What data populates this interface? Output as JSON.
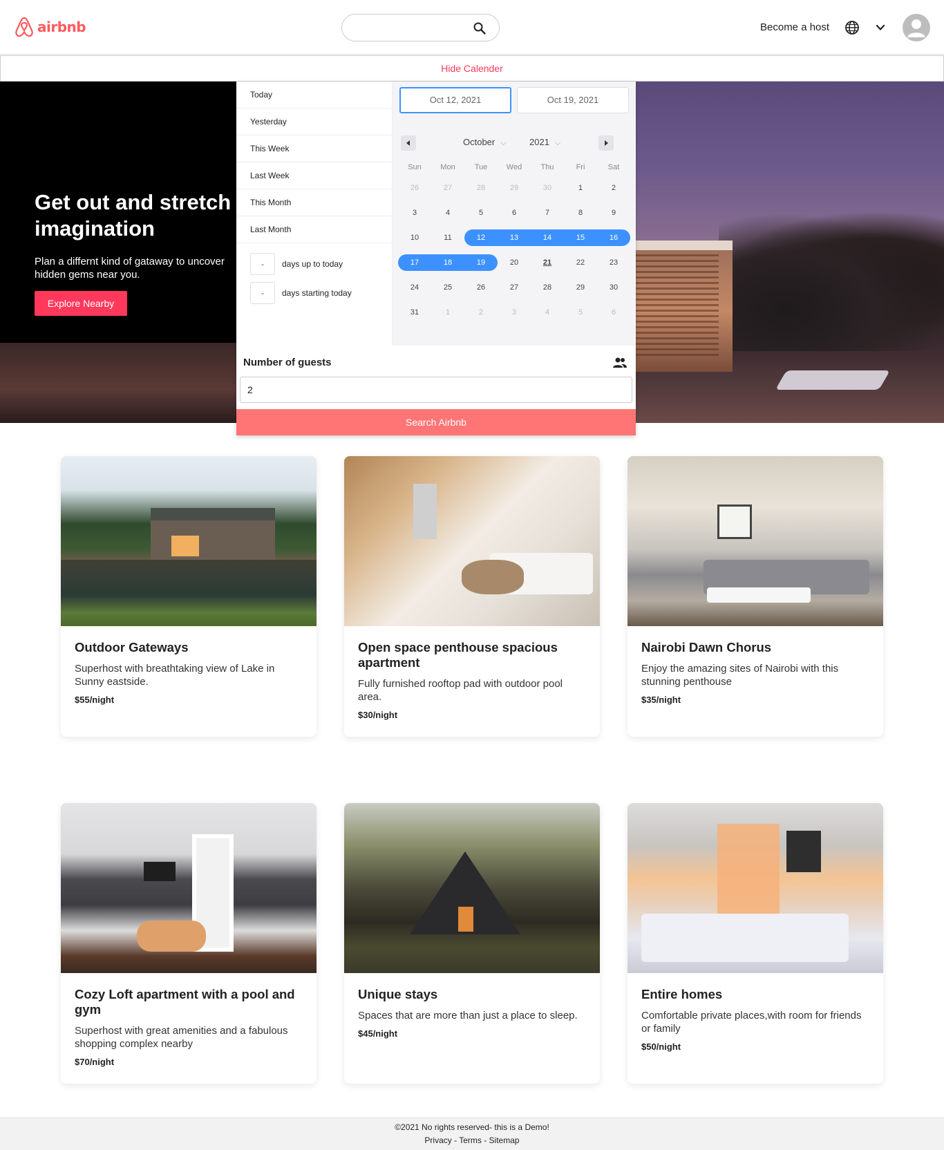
{
  "header": {
    "logo_text": "airbnb",
    "search_placeholder": "",
    "host_link": "Become a host"
  },
  "calendar_toggle": "Hide Calender",
  "hero": {
    "title": "Get out and stretch your imagination",
    "subtitle": "Plan a differnt kind of gataway to uncover hidden gems near you.",
    "button": "Explore Nearby"
  },
  "picker": {
    "ranges": [
      "Today",
      "Yesterday",
      "This Week",
      "Last Week",
      "This Month",
      "Last Month"
    ],
    "input_ranges": [
      {
        "value": "-",
        "label": "days up to today"
      },
      {
        "value": "-",
        "label": "days starting today"
      }
    ],
    "start_date": "Oct 12, 2021",
    "end_date": "Oct 19, 2021",
    "month": "October",
    "year": "2021",
    "weekdays": [
      "Sun",
      "Mon",
      "Tue",
      "Wed",
      "Thu",
      "Fri",
      "Sat"
    ],
    "weeks": [
      [
        "26",
        "27",
        "28",
        "29",
        "30",
        "1",
        "2"
      ],
      [
        "3",
        "4",
        "5",
        "6",
        "7",
        "8",
        "9"
      ],
      [
        "10",
        "11",
        "12",
        "13",
        "14",
        "15",
        "16"
      ],
      [
        "17",
        "18",
        "19",
        "20",
        "21",
        "22",
        "23"
      ],
      [
        "24",
        "25",
        "26",
        "27",
        "28",
        "29",
        "30"
      ],
      [
        "31",
        "1",
        "2",
        "3",
        "4",
        "5",
        "6"
      ]
    ],
    "guests_label": "Number of guests",
    "guests_value": "2",
    "search_button": "Search Airbnb"
  },
  "listings": [
    {
      "title": "Outdoor Gateways",
      "description": "Superhost with breathtaking view of Lake in Sunny eastside.",
      "price": "$55/night"
    },
    {
      "title": "Open space penthouse spacious apartment",
      "description": "Fully furnished rooftop pad with outdoor pool area.",
      "price": "$30/night"
    },
    {
      "title": "Nairobi Dawn Chorus",
      "description": "Enjoy the amazing sites of Nairobi with this stunning penthouse",
      "price": "$35/night"
    },
    {
      "title": "Cozy Loft apartment with a pool and gym",
      "description": "Superhost with great amenities and a fabulous shopping complex nearby",
      "price": "$70/night"
    },
    {
      "title": "Unique stays",
      "description": "Spaces that are more than just a place to sleep.",
      "price": "$45/night"
    },
    {
      "title": "Entire homes",
      "description": "Comfortable private places,with room for friends or family",
      "price": "$50/night"
    }
  ],
  "footer": {
    "copyright": "©2021 No rights reserved- this is a Demo!",
    "links": "Privacy - Terms - Sitemap"
  },
  "colors": {
    "brand": "#ff5a5f",
    "accent": "#ff385c",
    "selection": "#3d91ff",
    "search_button": "#ff7575"
  }
}
